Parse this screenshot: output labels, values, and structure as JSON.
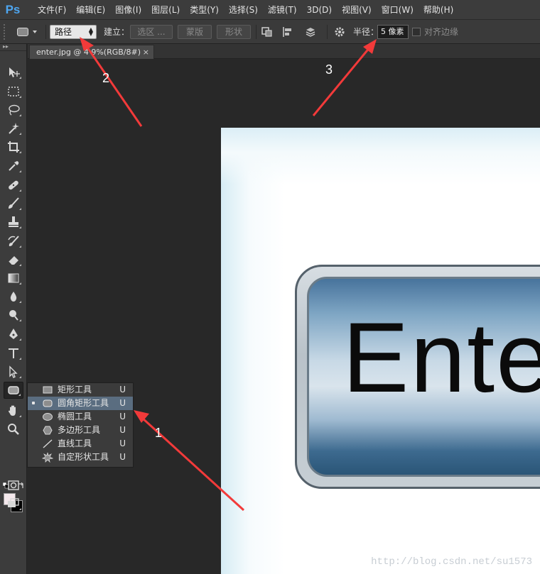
{
  "app": {
    "logo": "Ps"
  },
  "menu": {
    "items": [
      "文件(F)",
      "编辑(E)",
      "图像(I)",
      "图层(L)",
      "类型(Y)",
      "选择(S)",
      "滤镜(T)",
      "3D(D)",
      "视图(V)",
      "窗口(W)",
      "帮助(H)"
    ]
  },
  "options_bar": {
    "mode_value": "路径",
    "make_label": "建立：",
    "selection_btn": "选区 ...",
    "mask_btn": "蒙版",
    "shape_btn": "形状",
    "radius_label": "半径：",
    "radius_value": "5 像素",
    "align_edges_label": "对齐边缘"
  },
  "document": {
    "tab_title": "enter.jpg @ 4 9%(RGB/8#)",
    "close_symbol": "×",
    "image_text": "Ente",
    "watermark": "http://blog.csdn.net/su1573"
  },
  "flyout": {
    "items": [
      {
        "label": "矩形工具",
        "shortcut": "U",
        "icon": "rectangle-icon",
        "selected": false
      },
      {
        "label": "圆角矩形工具",
        "shortcut": "U",
        "icon": "rounded-rectangle-icon",
        "selected": true
      },
      {
        "label": "椭圆工具",
        "shortcut": "U",
        "icon": "ellipse-icon",
        "selected": false
      },
      {
        "label": "多边形工具",
        "shortcut": "U",
        "icon": "polygon-icon",
        "selected": false
      },
      {
        "label": "直线工具",
        "shortcut": "U",
        "icon": "line-icon",
        "selected": false
      },
      {
        "label": "自定形状工具",
        "shortcut": "U",
        "icon": "custom-shape-icon",
        "selected": false
      }
    ]
  },
  "annotations": {
    "n1": "1",
    "n2": "2",
    "n3": "3",
    "arrow_color": "#f23a3a"
  },
  "colors": {
    "foreground": "#f4e8ec",
    "background": "#000000",
    "selection": "#5a6d80"
  }
}
